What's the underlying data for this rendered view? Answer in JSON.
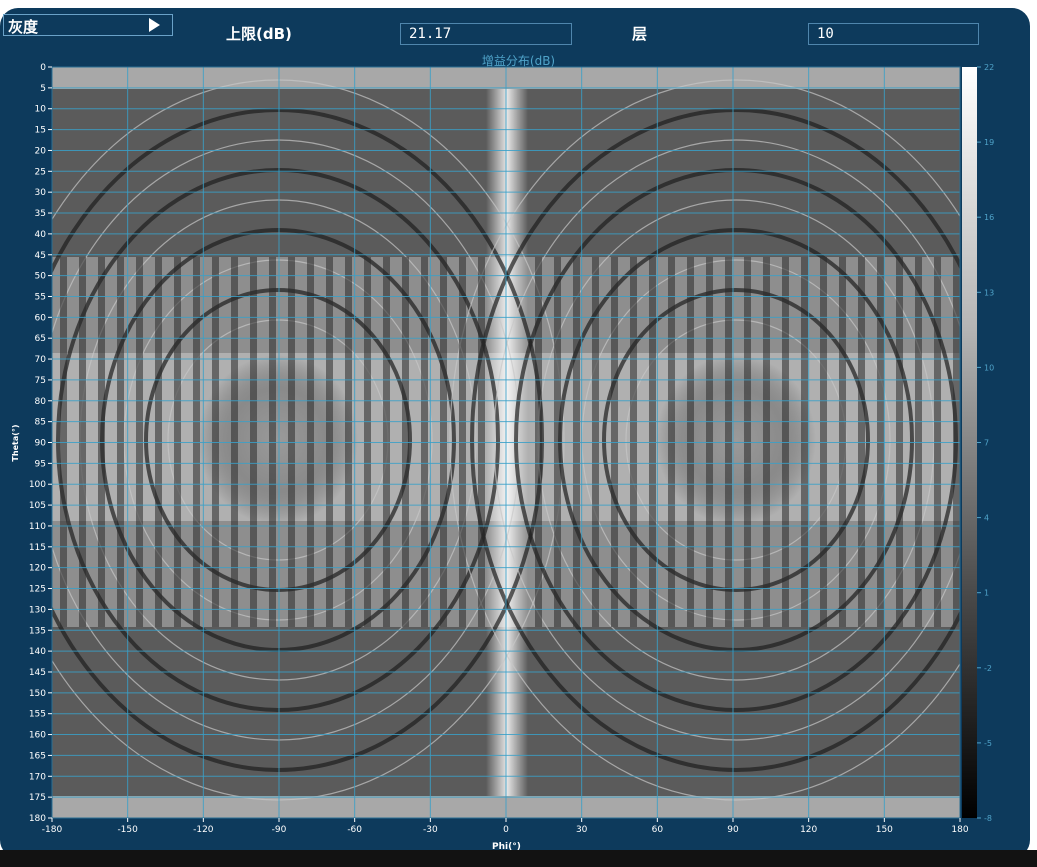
{
  "toolbar": {
    "colormap_label": "灰度",
    "upper_limit_label": "上限(dB)",
    "upper_limit_value": "21.17",
    "layers_label": "层",
    "layers_value": "10"
  },
  "chart_data": {
    "type": "heatmap",
    "title": "增益分布(dB)",
    "xlabel": "Phi(°)",
    "ylabel": "Theta(°)",
    "xlim": [
      -180,
      180
    ],
    "ylim": [
      0,
      180
    ],
    "x_ticks": [
      -180,
      -150,
      -120,
      -90,
      -60,
      -30,
      0,
      30,
      60,
      90,
      120,
      150,
      180
    ],
    "y_ticks": [
      0,
      5,
      10,
      15,
      20,
      25,
      30,
      35,
      40,
      45,
      50,
      55,
      60,
      65,
      70,
      75,
      80,
      85,
      90,
      95,
      100,
      105,
      110,
      115,
      120,
      125,
      130,
      135,
      140,
      145,
      150,
      155,
      160,
      165,
      170,
      175,
      180
    ],
    "colorbar": {
      "ticks": [
        22,
        19,
        16,
        13,
        10,
        7,
        4,
        1,
        -2,
        -5,
        -8
      ],
      "range": [
        -8,
        22
      ],
      "colormap": "grayscale"
    },
    "contour_levels": 10,
    "grid": true
  },
  "colors": {
    "frame": "#0d3a5c",
    "grid": "#3aa0c8",
    "tick_text_dark": "#ffffff",
    "title": "#4fa3c9"
  }
}
